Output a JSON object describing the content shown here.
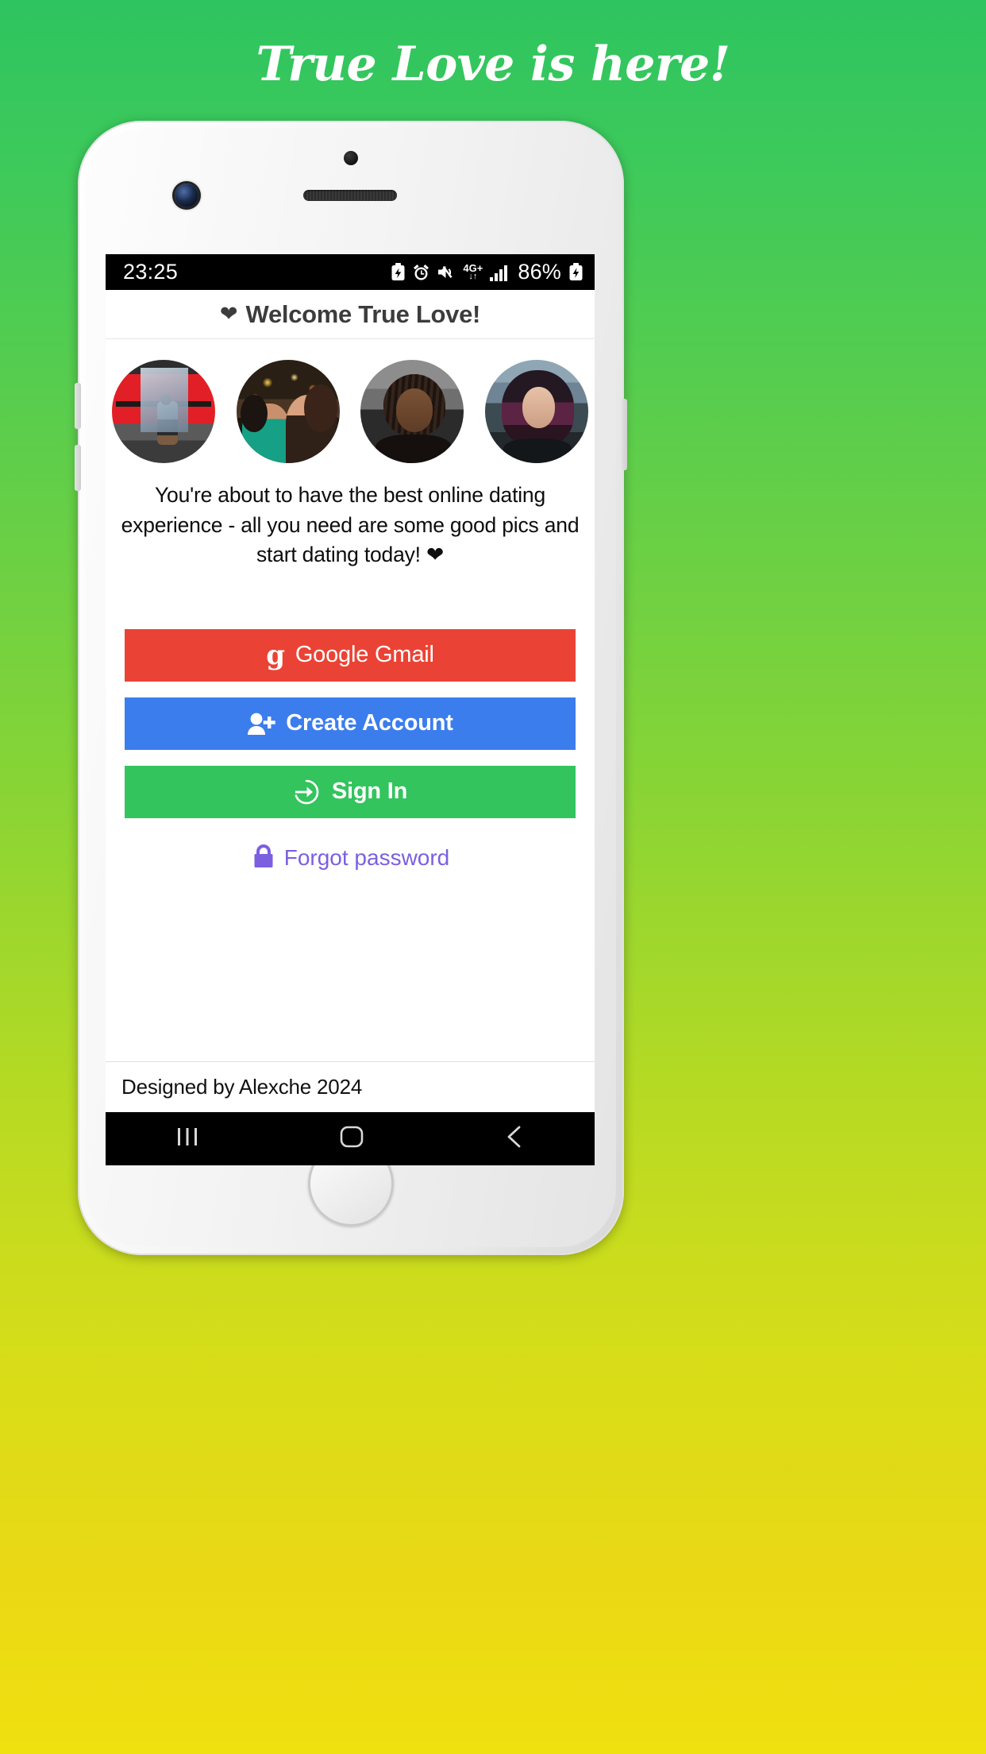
{
  "hero": {
    "title": "True Love is here!"
  },
  "statusbar": {
    "time": "23:25",
    "battery_percent": "86%",
    "network": {
      "generation": "4G+",
      "arrows": "↓↑"
    },
    "icons": [
      "battery-saver-icon",
      "alarm-icon",
      "mute-icon",
      "network-4gplus-icon",
      "signal-bars-icon",
      "battery-charging-icon"
    ]
  },
  "header": {
    "heart": "❤",
    "title": "Welcome True Love!"
  },
  "avatars": [
    {
      "name": "profile-photo-1",
      "alt": "woman at gym with barbell"
    },
    {
      "name": "profile-photo-2",
      "alt": "two women, one in teal dress at night"
    },
    {
      "name": "profile-photo-3",
      "alt": "woman with braided hair"
    },
    {
      "name": "profile-photo-4",
      "alt": "woman with dark purple hair outdoors"
    }
  ],
  "tagline": "You're about to have the best online dating experience - all you need are some good pics and start dating today! ❤",
  "buttons": {
    "gmail": {
      "label": "Google Gmail",
      "icon": "google-g-icon",
      "color": "#ea4335"
    },
    "create": {
      "label": "Create Account",
      "icon": "user-plus-icon",
      "color": "#3b7ded"
    },
    "signin": {
      "label": "Sign In",
      "icon": "sign-in-arrow-icon",
      "color": "#33c45d"
    }
  },
  "forgot": {
    "label": "Forgot password",
    "icon": "lock-icon",
    "color": "#7b5fe0"
  },
  "footer": {
    "text": "Designed by Alexche 2024"
  },
  "navbar": {
    "recents": "recents-icon",
    "home": "home-icon",
    "back": "back-icon"
  },
  "theme": {
    "bg_top": "#2ec45f",
    "bg_bottom": "#efe00f",
    "header_text": "#3c3c3c"
  }
}
